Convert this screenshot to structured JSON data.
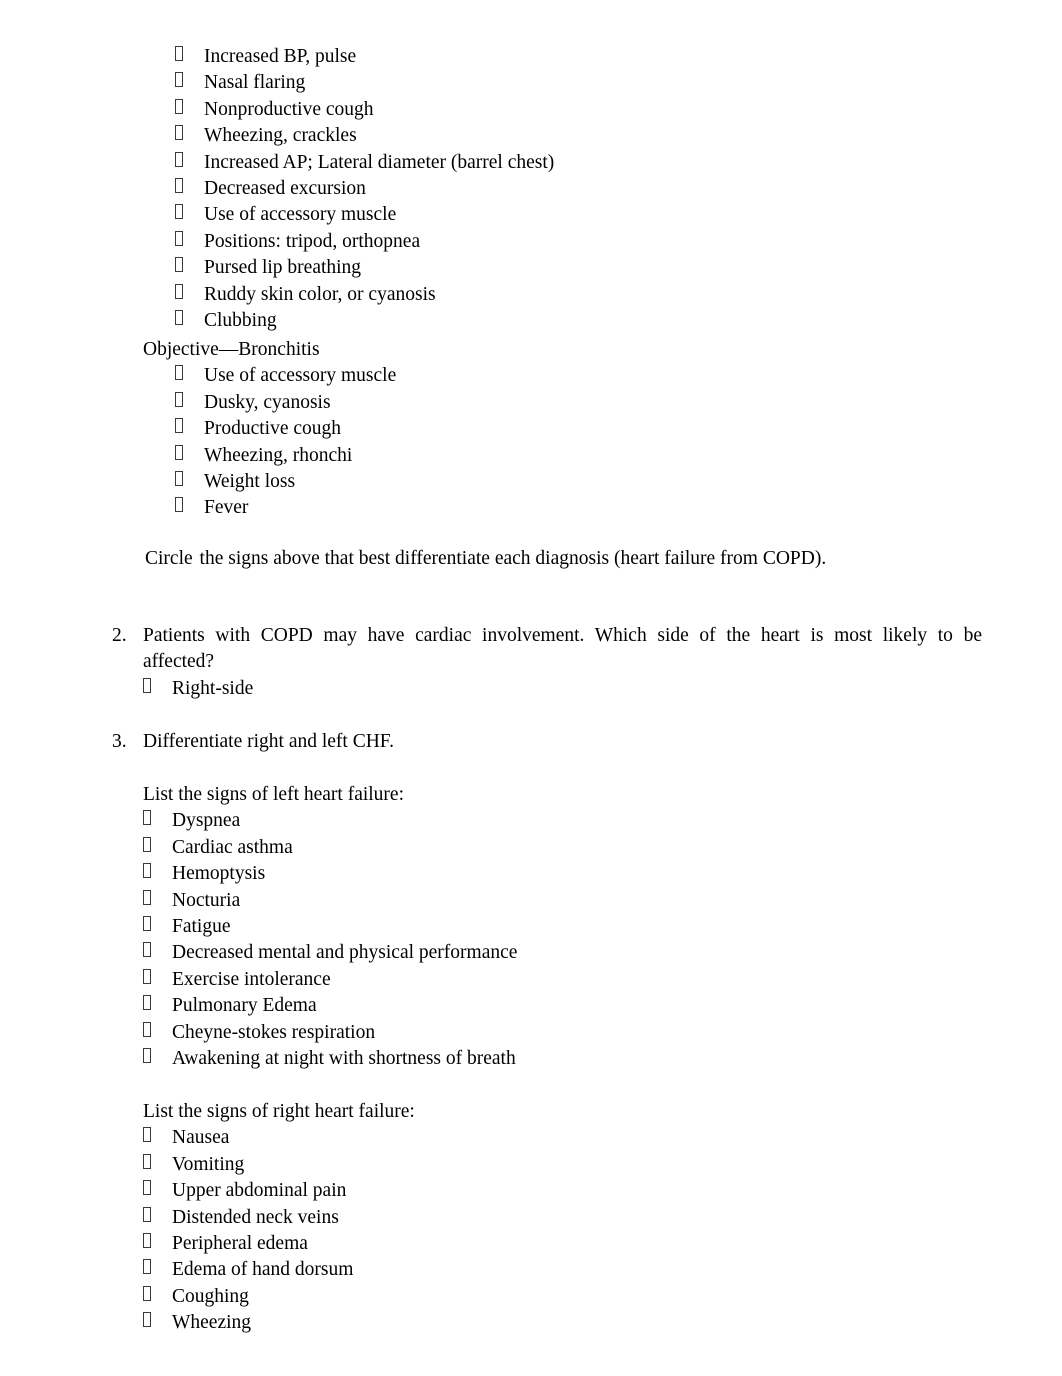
{
  "document": {
    "bullet_glyph": "tofu-box-glyph",
    "highlight_color": "#ffff00",
    "text_color": "#000000",
    "background_color": "#ffffff"
  },
  "objective_copd_signs": [
    "Increased BP, pulse",
    "Nasal flaring",
    "Nonproductive cough",
    "Wheezing, crackles",
    "Increased AP; Lateral diameter (barrel chest)",
    "Decreased excursion",
    "Use of accessory muscle",
    "Positions: tripod, orthopnea",
    "Pursed lip breathing",
    "Ruddy skin color, or cyanosis",
    "Clubbing"
  ],
  "objective_bronchitis": {
    "heading": "Objective—Bronchitis",
    "signs": [
      "Use of accessory muscle",
      "Dusky, cyanosis",
      "Productive cough",
      "Wheezing, rhonchi",
      "Weight loss",
      "Fever"
    ]
  },
  "circle_instruction": {
    "highlighted": "Circle",
    "rest": " the signs above that best differentiate each diagnosis (heart failure from COPD)."
  },
  "question_2": {
    "number": "2.",
    "text": "Patients with COPD may have cardiac involvement. Which side of the heart is most likely to be",
    "text_line2": "affected?",
    "answers": [
      "Right-side"
    ]
  },
  "question_3": {
    "number": "3.",
    "text": "Differentiate right and left CHF.",
    "left_heart": {
      "prompt": "List the signs of left heart failure:",
      "signs": [
        "Dyspnea",
        "Cardiac asthma",
        "Hemoptysis",
        "Nocturia",
        "Fatigue",
        "Decreased mental and physical performance",
        "Exercise intolerance",
        "Pulmonary Edema",
        "Cheyne-stokes respiration",
        "Awakening at night with shortness of breath"
      ]
    },
    "right_heart": {
      "prompt": "List the signs of right heart failure:",
      "signs": [
        "Nausea",
        "Vomiting",
        "Upper abdominal pain",
        "Distended neck veins",
        "Peripheral edema",
        "Edema of hand dorsum",
        "Coughing",
        "Wheezing"
      ]
    }
  }
}
